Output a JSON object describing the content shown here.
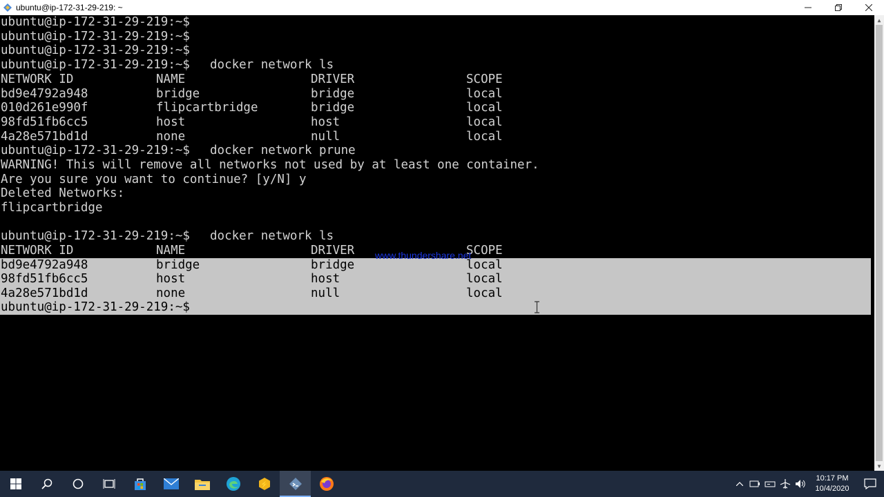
{
  "window": {
    "title": "ubuntu@ip-172-31-29-219: ~"
  },
  "terminal": {
    "prompt": "ubuntu@ip-172-31-29-219:~$",
    "cmd_ls": "docker network ls",
    "cmd_prune": "docker network prune",
    "headers": [
      "NETWORK ID",
      "NAME",
      "DRIVER",
      "SCOPE"
    ],
    "table1": [
      [
        "bd9e4792a948",
        "bridge",
        "bridge",
        "local"
      ],
      [
        "010d261e990f",
        "flipcartbridge",
        "bridge",
        "local"
      ],
      [
        "98fd51fb6cc5",
        "host",
        "host",
        "local"
      ],
      [
        "4a28e571bd1d",
        "none",
        "null",
        "local"
      ]
    ],
    "warning": "WARNING! This will remove all networks not used by at least one container.",
    "confirm": "Are you sure you want to continue? [y/N] y",
    "deleted_header": "Deleted Networks:",
    "deleted_item": "flipcartbridge",
    "table2": [
      [
        "bd9e4792a948",
        "bridge",
        "bridge",
        "local"
      ],
      [
        "98fd51fb6cc5",
        "host",
        "host",
        "local"
      ],
      [
        "4a28e571bd1d",
        "none",
        "null",
        "local"
      ]
    ]
  },
  "watermark": "www.thundershare.net",
  "taskbar": {
    "time": "10:17 PM",
    "date": "10/4/2020"
  },
  "colors": {
    "terminal_bg": "#000000",
    "terminal_fg": "#d2d2d2",
    "selection_bg": "#c6c6c6",
    "taskbar_bg": "#1f2a3d",
    "watermark": "#1a35e0"
  }
}
